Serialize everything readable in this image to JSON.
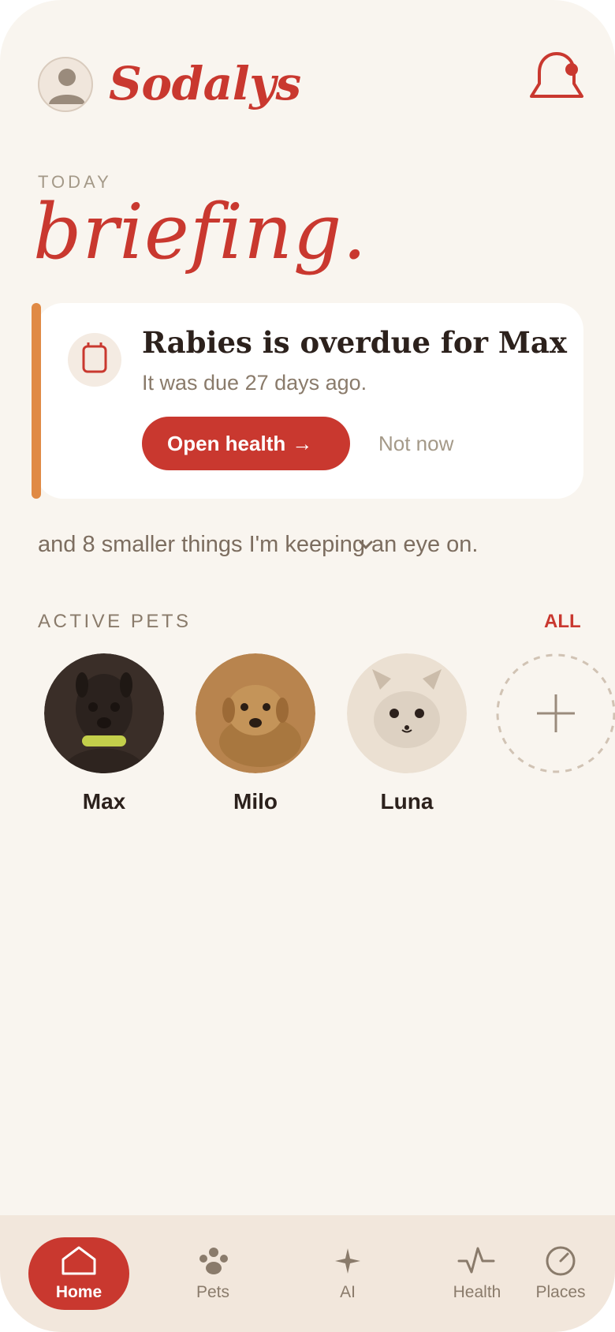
{
  "app": {
    "title": "Sodalys"
  },
  "header": {
    "section_label": "TODAY",
    "title": "briefing."
  },
  "alert": {
    "title": "Rabies is overdue for Max",
    "subtitle": "It was due 27 days ago.",
    "primary_action": "Open health",
    "primary_arrow": "→",
    "secondary_action": "Not now"
  },
  "summary": {
    "text": "and 8 smaller things I'm keeping an eye on."
  },
  "pets": {
    "heading": "ACTIVE PETS",
    "all_link": "ALL",
    "items": [
      {
        "name": "Max"
      },
      {
        "name": "Milo"
      },
      {
        "name": "Luna"
      }
    ]
  },
  "nav": {
    "items": [
      {
        "label": "Home",
        "icon": "home-icon",
        "active": true
      },
      {
        "label": "Pets",
        "icon": "paw-icon"
      },
      {
        "label": "AI",
        "icon": "sparkle-icon"
      },
      {
        "label": "Health",
        "icon": "pulse-icon"
      },
      {
        "label": "Places",
        "icon": "compass-icon"
      }
    ]
  },
  "colors": {
    "accent": "#c9382f",
    "background": "#f9f5ef",
    "card_accent": "#e08a45",
    "nav_background": "#f2e7dc"
  }
}
